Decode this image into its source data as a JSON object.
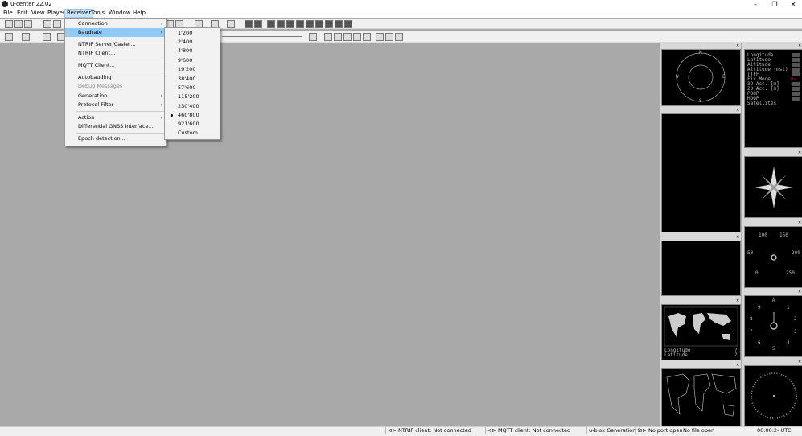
{
  "window": {
    "title": "u-center 22.02",
    "minimize": "–",
    "maximize": "❐",
    "close": "✕"
  },
  "menubar": [
    {
      "label": "File"
    },
    {
      "label": "Edit"
    },
    {
      "label": "View"
    },
    {
      "label": "Player"
    },
    {
      "label": "Receiver"
    },
    {
      "label": "Tools"
    },
    {
      "label": "Window"
    },
    {
      "label": "Help"
    }
  ],
  "receiver_menu": {
    "items": [
      {
        "label": "Connection",
        "submenu": true
      },
      {
        "label": "Baudrate",
        "submenu": true,
        "highlighted": true
      },
      {
        "label": "NTRIP Server/Caster..."
      },
      {
        "label": "NTRIP Client..."
      },
      {
        "label": "MQTT Client..."
      },
      {
        "label": "Autobauding"
      },
      {
        "label": "Debug Messages",
        "disabled": true
      },
      {
        "label": "Generation",
        "submenu": true
      },
      {
        "label": "Protocol Filter",
        "submenu": true
      },
      {
        "label": "Action",
        "submenu": true
      },
      {
        "label": "Differential GNSS Interface..."
      },
      {
        "label": "Epoch detection..."
      }
    ]
  },
  "baudrate_menu": {
    "items": [
      "1'200",
      "2'400",
      "4'800",
      "9'600",
      "19'200",
      "38'400",
      "57'600",
      "115'200",
      "230'400",
      "460'800",
      "921'600",
      "Custom"
    ],
    "selected": "460'800"
  },
  "data_view": {
    "labels": [
      "Longitude",
      "Latitude",
      "Altitude",
      "Altitude (msl)",
      "TTFF",
      "Fix Mode",
      "3D Acc. [m]",
      "2D Acc. [m]",
      "PDOP",
      "HDOP",
      "Satellites"
    ],
    "fix_mode_value": "No Fix"
  },
  "compass": {
    "n": "N",
    "s": "S",
    "e": "E",
    "w": "W"
  },
  "speed_gauge": {
    "t100": "100",
    "t150": "150",
    "t50": "50",
    "t200": "200",
    "t0": "0",
    "t250": "250"
  },
  "clock_gauge": {
    "t0": "0",
    "t1": "1",
    "t2": "2",
    "t3": "3",
    "t4": "4",
    "t5": "5",
    "t6": "6",
    "t7": "7",
    "t8": "8",
    "t9": "9"
  },
  "world_map": {
    "longitude_label": "Longitude",
    "latitude_label": "Latitude",
    "longitude_value": "?",
    "latitude_value": "?"
  },
  "statusbar": {
    "ntrip": "NTRIP client: Not connected",
    "mqtt": "MQTT client: Not connected",
    "generation": "u-blox Generation 9",
    "port": "No port open",
    "file": "No file open",
    "time": "00:00:2- UTC"
  },
  "colors": {
    "accent": "#91c9f7",
    "fix_mode": "#cc0000"
  }
}
